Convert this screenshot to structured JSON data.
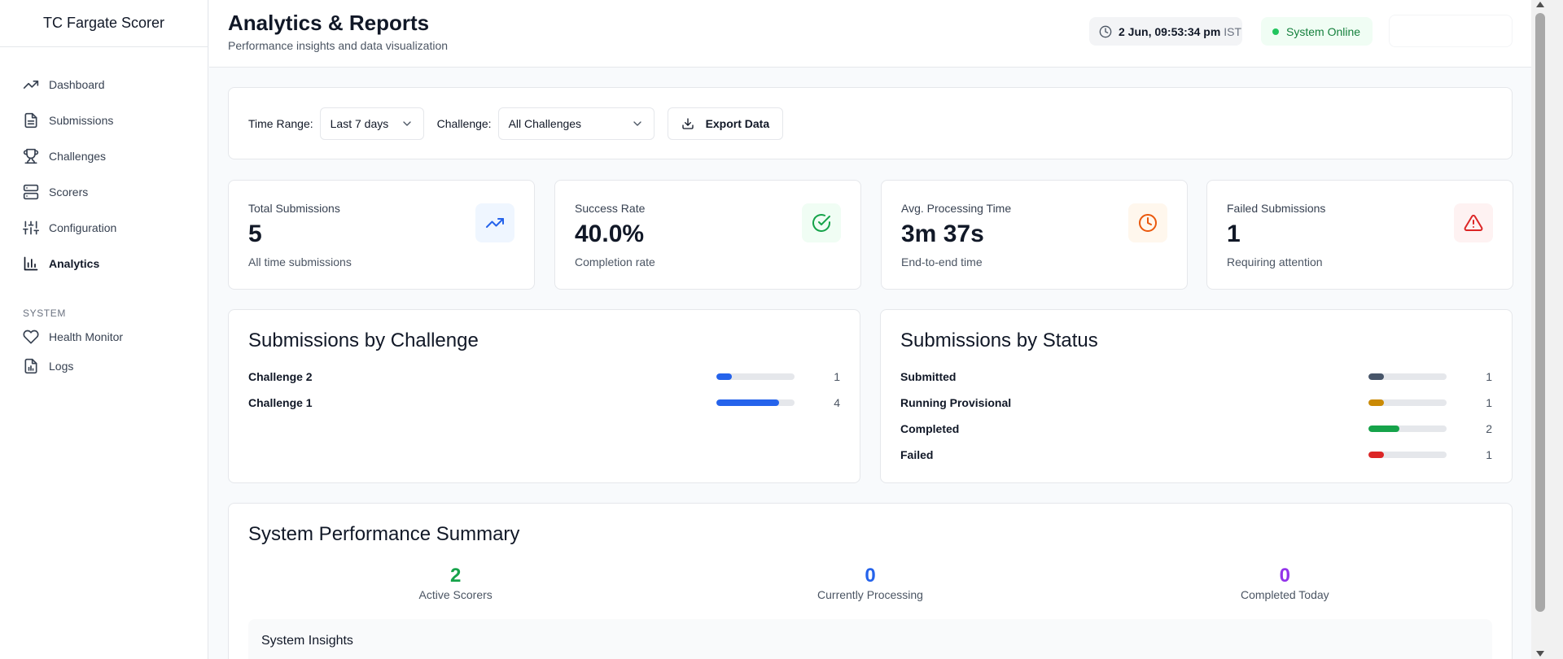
{
  "app": {
    "title": "TC Fargate Scorer"
  },
  "sidebar": {
    "items": [
      {
        "label": "Dashboard",
        "icon": "trending-up-icon"
      },
      {
        "label": "Submissions",
        "icon": "file-text-icon"
      },
      {
        "label": "Challenges",
        "icon": "trophy-icon"
      },
      {
        "label": "Scorers",
        "icon": "server-icon"
      },
      {
        "label": "Configuration",
        "icon": "sliders-icon"
      },
      {
        "label": "Analytics",
        "icon": "bar-chart-icon",
        "active": true
      }
    ],
    "system_label": "SYSTEM",
    "system_items": [
      {
        "label": "Health Monitor",
        "icon": "heart-icon"
      },
      {
        "label": "Logs",
        "icon": "file-chart-icon"
      }
    ]
  },
  "header": {
    "title": "Analytics & Reports",
    "subtitle": "Performance insights and data visualization",
    "clock_time": "2 Jun, 09:53:34 pm",
    "clock_tz": "IST",
    "status": "System Online"
  },
  "filters": {
    "time_range_label": "Time Range:",
    "time_range_value": "Last 7 days",
    "challenge_label": "Challenge:",
    "challenge_value": "All Challenges",
    "export_label": "Export Data"
  },
  "stats": [
    {
      "title": "Total Submissions",
      "value": "5",
      "desc": "All time submissions",
      "icon": "trending-up-icon",
      "color": "#2563eb",
      "bg": "#eff6ff"
    },
    {
      "title": "Success Rate",
      "value": "40.0%",
      "desc": "Completion rate",
      "icon": "check-circle-icon",
      "color": "#16a34a",
      "bg": "#f0fdf4"
    },
    {
      "title": "Avg. Processing Time",
      "value": "3m 37s",
      "desc": "End-to-end time",
      "icon": "clock-icon",
      "color": "#ea580c",
      "bg": "#fff7ed"
    },
    {
      "title": "Failed Submissions",
      "value": "1",
      "desc": "Requiring attention",
      "icon": "alert-triangle-icon",
      "color": "#dc2626",
      "bg": "#fef2f2"
    }
  ],
  "by_challenge": {
    "title": "Submissions by Challenge",
    "rows": [
      {
        "name": "Challenge 2",
        "count": "1",
        "fraction": 0.2,
        "color": "#2563eb"
      },
      {
        "name": "Challenge 1",
        "count": "4",
        "fraction": 0.8,
        "color": "#2563eb"
      }
    ]
  },
  "by_status": {
    "title": "Submissions by Status",
    "rows": [
      {
        "name": "Submitted",
        "count": "1",
        "fraction": 0.2,
        "color": "#475569"
      },
      {
        "name": "Running Provisional",
        "count": "1",
        "fraction": 0.2,
        "color": "#ca8a04"
      },
      {
        "name": "Completed",
        "count": "2",
        "fraction": 0.4,
        "color": "#16a34a"
      },
      {
        "name": "Failed",
        "count": "1",
        "fraction": 0.2,
        "color": "#dc2626"
      }
    ]
  },
  "performance": {
    "title": "System Performance Summary",
    "metrics": [
      {
        "value": "2",
        "label": "Active Scorers",
        "color": "#16a34a"
      },
      {
        "value": "0",
        "label": "Currently Processing",
        "color": "#2563eb"
      },
      {
        "value": "0",
        "label": "Completed Today",
        "color": "#9333ea"
      }
    ],
    "insights_title": "System Insights"
  }
}
